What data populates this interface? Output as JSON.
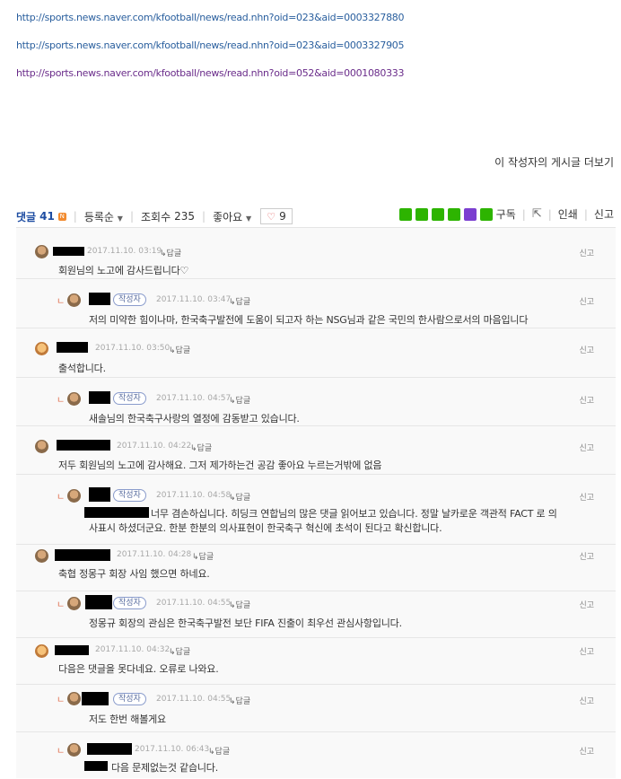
{
  "links": [
    {
      "text": "http://sports.news.naver.com/kfootball/news/read.nhn?oid=023&aid=0003327880",
      "visited": false
    },
    {
      "text": "http://sports.news.naver.com/kfootball/news/read.nhn?oid=023&aid=0003327905",
      "visited": false
    },
    {
      "text": "http://sports.news.naver.com/kfootball/news/read.nhn?oid=052&aid=0001080333",
      "visited": true
    }
  ],
  "more_posts": "이 작성자의 게시글 더보기",
  "toolbar": {
    "comments_label": "댓글",
    "comments_count": "41",
    "new_badge": "N",
    "sort_label": "등록순",
    "views_label": "조회수",
    "views_count": "235",
    "like_label": "좋아요",
    "like_count": "9",
    "subscribe": "구독",
    "print": "인쇄",
    "report": "신고"
  },
  "comments": [
    {
      "date": "2017.11.10. 03:19",
      "reply": "답글",
      "report": "신고",
      "body": "회원님의 노고에 감사드립니다♡",
      "writer": ""
    },
    {
      "date": "2017.11.10. 03:47",
      "reply": "답글",
      "report": "신고",
      "body": "저의 미약한 힘이나마, 한국축구발전에 도움이 되고자 하는 NSG님과 같은 국민의 한사람으로서의 마음입니다",
      "writer": "작성자"
    },
    {
      "date": "2017.11.10. 03:50",
      "reply": "답글",
      "report": "신고",
      "body": "출석합니다.",
      "writer": ""
    },
    {
      "date": "2017.11.10. 04:57",
      "reply": "답글",
      "report": "신고",
      "body": "새솔님의 한국축구사랑의 열정에 감동받고 있습니다.",
      "writer": "작성자"
    },
    {
      "date": "2017.11.10. 04:22",
      "reply": "답글",
      "report": "신고",
      "body": "저두 회원님의 노고에 감사해요. 그저 제가하는건 공감 좋아요 누르는거밖에 없음",
      "writer": ""
    },
    {
      "date": "2017.11.10. 04:58",
      "reply": "답글",
      "report": "신고",
      "body": "너무 겸손하십니다. 히딩크 연합님의 많은 댓글 읽어보고 있습니다. 정말 날카로운 객관적 FACT 로 의",
      "body2": "사표시 하셨더군요. 한분 한분의 의사표현이 한국축구 혁신에 초석이 된다고 확신합니다.",
      "writer": "작성자"
    },
    {
      "date": "2017.11.10. 04:28",
      "reply": "답글",
      "report": "신고",
      "body": "축협 정몽구 회장 사임 했으면 하네요.",
      "writer": ""
    },
    {
      "date": "2017.11.10. 04:55",
      "reply": "답글",
      "report": "신고",
      "body": "정몽규 회장의 관심은 한국축구발전 보단 FIFA 진출이 최우선 관심사항입니다.",
      "writer": "작성자"
    },
    {
      "date": "2017.11.10. 04:32",
      "reply": "답글",
      "report": "신고",
      "body": "다음은 댓글을 못다네요. 오류로 나와요.",
      "writer": ""
    },
    {
      "date": "2017.11.10. 04:55",
      "reply": "답글",
      "report": "신고",
      "body": "저도 한번 해볼게요",
      "writer": "작성자"
    },
    {
      "date": "2017.11.10. 06:43",
      "reply": "답글",
      "report": "신고",
      "body": "다음 문제없는것 같습니다.",
      "writer": ""
    }
  ]
}
